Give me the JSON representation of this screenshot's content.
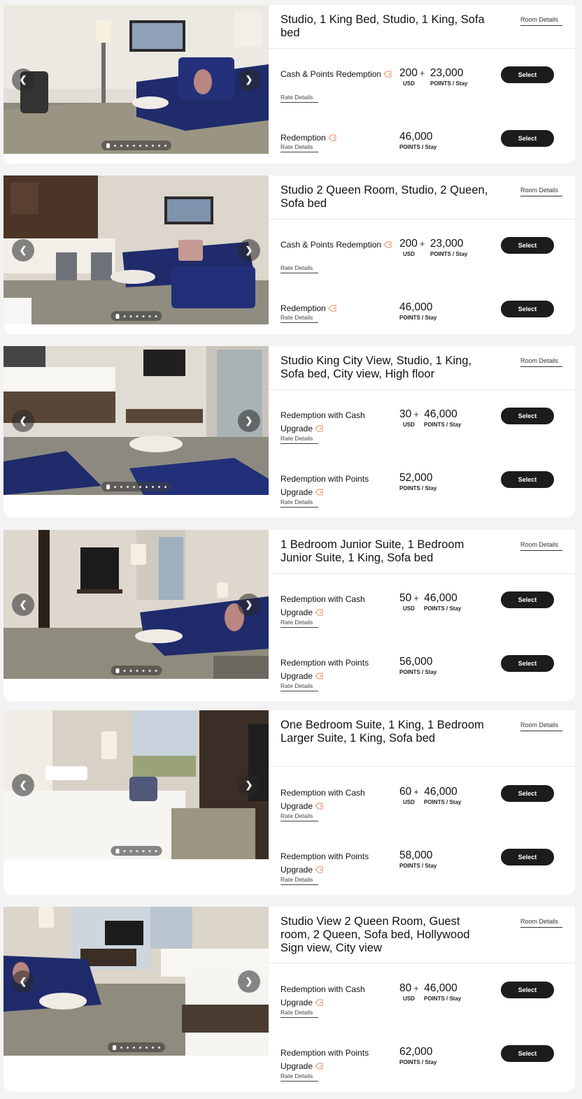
{
  "rooms": [
    {
      "title": "Studio, 1 King Bed, Studio, 1 King, Sofa bed",
      "room_details": "Room Details",
      "photo_dots": 10,
      "photo_active_dot": 1,
      "rates": [
        {
          "name": "Cash & Points Redemption",
          "cash": "200",
          "cash_unit": "USD",
          "points": "23,000",
          "points_unit": "POINTS / Stay",
          "link": "Rate Details",
          "button": "Select"
        },
        {
          "name": "Redemption",
          "cash": "",
          "cash_unit": "",
          "points": "46,000",
          "points_unit": "POINTS / Stay",
          "link": "Rate Details",
          "button": "Select"
        }
      ]
    },
    {
      "title": "Studio 2 Queen Room, Studio, 2 Queen, Sofa bed",
      "room_details": "Room Details",
      "photo_dots": 7,
      "photo_active_dot": 1,
      "rates": [
        {
          "name": "Cash & Points Redemption",
          "cash": "200",
          "cash_unit": "USD",
          "points": "23,000",
          "points_unit": "POINTS / Stay",
          "link": "Rate Details",
          "button": "Select"
        },
        {
          "name": "Redemption",
          "cash": "",
          "cash_unit": "",
          "points": "46,000",
          "points_unit": "POINTS / Stay",
          "link": "Rate Details",
          "button": "Select"
        }
      ]
    },
    {
      "title": "Studio King City View, Studio, 1 King, Sofa bed, City view, High floor",
      "room_details": "Room Details",
      "photo_dots": 10,
      "photo_active_dot": 1,
      "rates": [
        {
          "name": "Redemption with Cash Upgrade",
          "cash": "30",
          "cash_unit": "USD",
          "points": "46,000",
          "points_unit": "POINTS / Stay",
          "link": "Rate Details",
          "button": "Select"
        },
        {
          "name": "Redemption with Points Upgrade",
          "cash": "",
          "cash_unit": "",
          "points": "52,000",
          "points_unit": "POINTS / Stay",
          "link": "Rate Details",
          "button": "Select"
        }
      ]
    },
    {
      "title": "1 Bedroom Junior Suite, 1 Bedroom Junior Suite, 1 King, Sofa bed",
      "room_details": "Room Details",
      "photo_dots": 7,
      "photo_active_dot": 1,
      "rates": [
        {
          "name": "Redemption with Cash Upgrade",
          "cash": "50",
          "cash_unit": "USD",
          "points": "46,000",
          "points_unit": "POINTS / Stay",
          "link": "Rate Details",
          "button": "Select"
        },
        {
          "name": "Redemption with Points Upgrade",
          "cash": "",
          "cash_unit": "",
          "points": "56,000",
          "points_unit": "POINTS / Stay",
          "link": "Rate Details",
          "button": "Select"
        }
      ]
    },
    {
      "title": "One Bedroom Suite, 1 King, 1 Bedroom Larger Suite, 1 King, Sofa bed",
      "room_details": "Room Details",
      "photo_dots": 7,
      "photo_active_dot": 1,
      "rates": [
        {
          "name": "Redemption with Cash Upgrade",
          "cash": "60",
          "cash_unit": "USD",
          "points": "46,000",
          "points_unit": "POINTS / Stay",
          "link": "Rate Details",
          "button": "Select"
        },
        {
          "name": "Redemption with Points Upgrade",
          "cash": "",
          "cash_unit": "",
          "points": "58,000",
          "points_unit": "POINTS / Stay",
          "link": "Rate Details",
          "button": "Select"
        }
      ]
    },
    {
      "title": "Studio View 2 Queen Room, Guest room, 2 Queen, Sofa bed, Hollywood Sign view, City view",
      "room_details": "Room Details",
      "photo_dots": 8,
      "photo_active_dot": 1,
      "rates": [
        {
          "name": "Redemption with Cash Upgrade",
          "cash": "80",
          "cash_unit": "USD",
          "points": "46,000",
          "points_unit": "POINTS / Stay",
          "link": "Rate Details",
          "button": "Select"
        },
        {
          "name": "Redemption with Points Upgrade",
          "cash": "",
          "cash_unit": "",
          "points": "62,000",
          "points_unit": "POINTS / Stay",
          "link": "Rate Details",
          "button": "Select"
        }
      ]
    }
  ],
  "colors": {
    "accent": "#f08a5d",
    "button": "#1c1c1c",
    "sofa": "#1f2b6b"
  },
  "icons": {
    "prev": "chevron-left-icon",
    "next": "chevron-right-icon",
    "tag": "tag-icon"
  }
}
